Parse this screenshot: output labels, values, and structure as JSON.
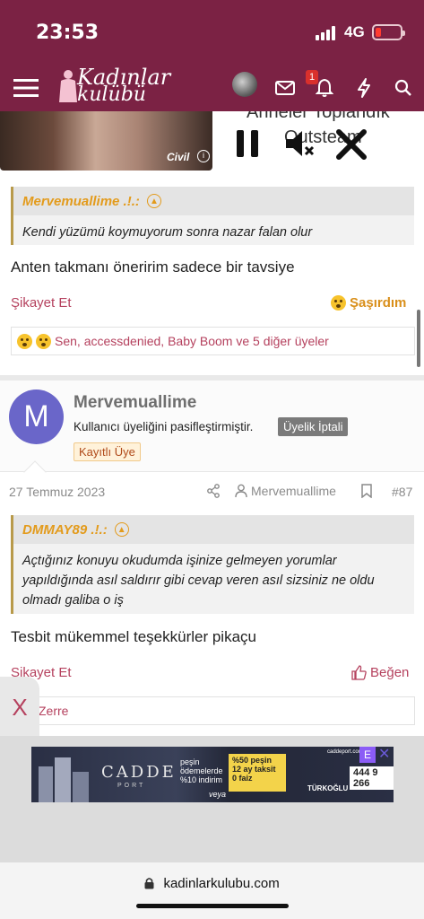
{
  "status": {
    "time": "23:53",
    "network": "4G"
  },
  "nav": {
    "brand_line1": "Kadınlar",
    "brand_line2": "kulübü",
    "notif_count": "1"
  },
  "video": {
    "brand": "Civil",
    "info_icon": "i",
    "title_partial": "Anneler Toplandık",
    "player_brand": "Outsteam"
  },
  "post1": {
    "quote_author": "Mervemuallime .!.:",
    "quote_text": "Kendi yüzümü koymuyorum sonra nazar falan olur",
    "message": "Anten takmanı öneririm sadece bir tavsiye",
    "report_label": "Şikayet Et",
    "reaction_label": "Şaşırdım",
    "reactions_text": "Sen, accessdenied, Baby Boom ve 5 diğer üyeler"
  },
  "user": {
    "avatar_letter": "M",
    "name": "Mervemuallime",
    "status": "Kullanıcı üyeliğini pasifleştirmiştir.",
    "cancel_badge": "Üyelik İptali",
    "role_badge": "Kayıtlı Üye"
  },
  "post2": {
    "date": "27 Temmuz 2023",
    "author": "Mervemuallime",
    "number": "#87",
    "quote_author": "DMMAY89 .!.:",
    "quote_text": "Açtığınız konuyu okudumda işinize gelmeyen yorumlar yapıldığında asıl saldırır gibi cevap veren asıl sizsiniz ne oldu olmadı galiba o iş",
    "message": "Tesbit mükemmel teşekkürler pikaçu",
    "report_label": "Şikayet Et",
    "like_label": "Beğen",
    "reactions_text": "Zerre"
  },
  "overlay": {
    "close_label": "X"
  },
  "ad": {
    "brand": "CADDE",
    "brand_sub": "PORT",
    "site": "caddeport.com",
    "payment_text": "peşin ödemelerde %10 indirim",
    "offer_text": "%50 peşin 12 ay taksit 0 faiz",
    "veya": "veya",
    "developer": "TÜRKOĞLU",
    "phone": "444 9 266",
    "tag": "E",
    "close": "✕"
  },
  "browser": {
    "url": "kadinlarkulubu.com"
  }
}
